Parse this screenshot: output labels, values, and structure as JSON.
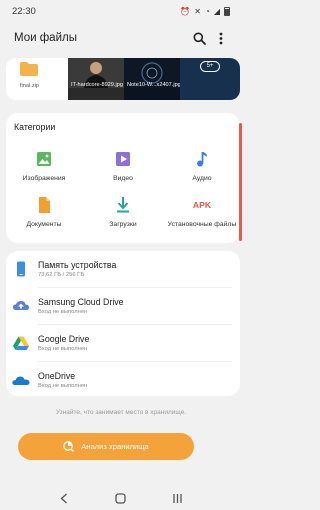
{
  "status_bar": {
    "time": "22:30",
    "battery_icon": "battery-icon"
  },
  "app_bar": {
    "title": "Мои файлы",
    "search_icon": "search-icon",
    "more_icon": "more-vert-icon"
  },
  "recent": {
    "items": [
      {
        "name": "final.zip",
        "kind": "zip"
      },
      {
        "name": "IT-hardcore-8929.jpg",
        "kind": "image"
      },
      {
        "name": "Note10-W...x2407.jpg",
        "kind": "image"
      },
      {
        "name": "",
        "kind": "image",
        "badge": "5+"
      }
    ]
  },
  "categories": {
    "title": "Категории",
    "items": [
      {
        "label": "Изображения",
        "icon": "image-icon",
        "color": "#5cb85c"
      },
      {
        "label": "Видео",
        "icon": "video-icon",
        "color": "#8e6fd6"
      },
      {
        "label": "Аудио",
        "icon": "music-icon",
        "color": "#3b7fe0"
      },
      {
        "label": "Документы",
        "icon": "document-icon",
        "color": "#f0a030"
      },
      {
        "label": "Загрузки",
        "icon": "download-icon",
        "color": "#2aa49e"
      },
      {
        "label": "Установочные файлы",
        "icon": "apk-icon",
        "color": "#e0584a",
        "icon_text": "APK"
      }
    ]
  },
  "storage": {
    "items": [
      {
        "title": "Память устройства",
        "subtitle": "73,62 ГБ / 256 ГБ",
        "icon": "phone-icon"
      },
      {
        "title": "Samsung Cloud Drive",
        "subtitle": "Вход не выполнен",
        "icon": "samsung-cloud-icon"
      },
      {
        "title": "Google Drive",
        "subtitle": "Вход не выполнен",
        "icon": "google-drive-icon"
      },
      {
        "title": "OneDrive",
        "subtitle": "Вход не выполнен",
        "icon": "onedrive-icon"
      }
    ]
  },
  "hint": "Узнайте, что занимает место в хранилище.",
  "analyze_button": {
    "label": "Анализ хранилища",
    "icon": "storage-analysis-icon"
  },
  "nav": {
    "back_icon": "back-icon",
    "home_icon": "home-icon",
    "recents_icon": "recents-icon"
  },
  "colors": {
    "accent": "#f4a23a",
    "scroll_accent": "#e25b4e",
    "phone_blue": "#3a8fe0"
  }
}
